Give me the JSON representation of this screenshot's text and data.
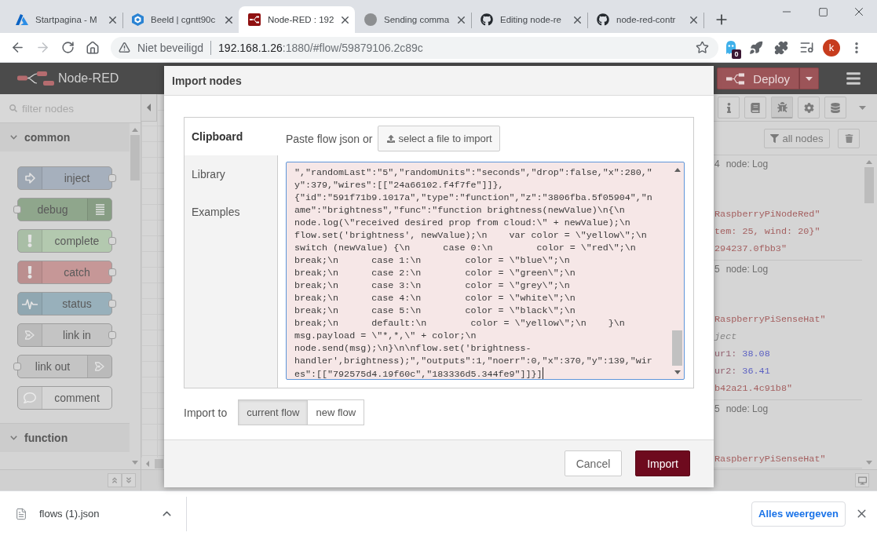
{
  "browser": {
    "tabs": [
      {
        "title": "Startpagina - M",
        "selected": false
      },
      {
        "title": "Beeld | cgntt90c",
        "selected": false
      },
      {
        "title": "Node-RED : 192",
        "selected": true
      },
      {
        "title": "Sending comma",
        "selected": false
      },
      {
        "title": "Editing node-re",
        "selected": false
      },
      {
        "title": "node-red-contr",
        "selected": false
      }
    ],
    "toolbar": {
      "forward_disabled": true,
      "security": "Niet beveiligd",
      "url_host": "192.168.1.26",
      "url_rest": ":1880/#flow/59879106.2c89c",
      "extension_badge": "0",
      "profile_initial": "k"
    }
  },
  "app": {
    "title": "Node-RED",
    "deploy": "Deploy",
    "palette": {
      "filter_placeholder": "filter nodes",
      "categories": [
        {
          "name": "common",
          "expanded": true,
          "nodes": [
            {
              "label": "inject",
              "kind": "input",
              "color": "#a6b0bd"
            },
            {
              "label": "debug",
              "kind": "output",
              "color": "#8fa68c"
            },
            {
              "label": "complete",
              "kind": "input",
              "color": "#b3c9af"
            },
            {
              "label": "catch",
              "kind": "input",
              "color": "#c69797"
            },
            {
              "label": "status",
              "kind": "input",
              "color": "#98b0bb"
            },
            {
              "label": "link in",
              "kind": "input",
              "color": "#c4c4c4"
            },
            {
              "label": "link out",
              "kind": "output",
              "color": "#c4c4c4"
            },
            {
              "label": "comment",
              "kind": "note",
              "color": "#d6d6d6"
            }
          ]
        },
        {
          "name": "function",
          "expanded": true
        }
      ]
    },
    "sidebar": {
      "tabs": [
        {
          "selected": false
        },
        {
          "selected": false
        },
        {
          "selected": true
        },
        {
          "selected": false
        },
        {
          "selected": false
        }
      ],
      "filter": "all nodes",
      "messages": [
        {
          "counter": "4",
          "node": "node: Log",
          "lines": [
            {
              "kind": "string",
              "text": "RaspberryPiNodeRed\""
            },
            {
              "kind": "string",
              "text": "tem: 25, wind: 20}\""
            },
            {
              "kind": "string",
              "text": "294237.0fbb3\""
            }
          ]
        },
        {
          "counter": "5",
          "node": "node: Log",
          "lines": [
            {
              "kind": "string",
              "text": "RaspberryPiSenseHat\""
            },
            {
              "kind": "type",
              "text": "ject"
            },
            {
              "kind": "number",
              "key": "ur1:",
              "value": "38.08"
            },
            {
              "kind": "number",
              "key": "ur2:",
              "value": "36.41"
            },
            {
              "kind": "string",
              "text": "b42a21.4c91b8\""
            }
          ]
        },
        {
          "counter": "5",
          "node": "node: Log",
          "lines": [
            {
              "kind": "string",
              "text": "RaspberryPiSenseHat\""
            }
          ]
        }
      ]
    }
  },
  "dialog": {
    "title": "Import nodes",
    "sources": [
      {
        "label": "Clipboard",
        "selected": true
      },
      {
        "label": "Library",
        "selected": false
      },
      {
        "label": "Examples",
        "selected": false
      }
    ],
    "paste_label": "Paste flow json or",
    "file_button": "select a file to import",
    "json_error": true,
    "json_lines": [
      "\",\"randomLast\":\"5\",\"randomUnits\":\"seconds\",\"drop\":false,\"x\":280,\"",
      "y\":379,\"wires\":[[\"24a66102.f4f7fe\"]]},",
      "{\"id\":\"591f71b9.1017a\",\"type\":\"function\",\"z\":\"3806fba.5f05904\",\"n",
      "ame\":\"brightness\",\"func\":\"function brightness(newValue)\\n{\\n",
      "node.log(\\\"received desired prop from cloud:\\\" + newValue);\\n",
      "flow.set('brightness', newValue);\\n    var color = \\\"yellow\\\";\\n",
      "switch (newValue) {\\n      case 0:\\n        color = \\\"red\\\";\\n",
      "break;\\n      case 1:\\n        color = \\\"blue\\\";\\n",
      "break;\\n      case 2:\\n        color = \\\"green\\\";\\n",
      "break;\\n      case 3:\\n        color = \\\"grey\\\";\\n",
      "break;\\n      case 4:\\n        color = \\\"white\\\";\\n",
      "break;\\n      case 5:\\n        color = \\\"black\\\";\\n",
      "break;\\n      default:\\n        color = \\\"yellow\\\";\\n    }\\n",
      "msg.payload = \\\"*,*,\\\" + color;\\n",
      "node.send(msg);\\n}\\n\\nflow.set('brightness-",
      "handler',brightness);\",\"outputs\":1,\"noerr\":0,\"x\":370,\"y\":139,\"wir",
      "es\":[[\"792575d4.19f60c\",\"183336d5.344fe9\"]]}]"
    ],
    "import_to_label": "Import to",
    "import_targets": [
      {
        "label": "current flow",
        "selected": true
      },
      {
        "label": "new flow",
        "selected": false
      }
    ],
    "buttons": [
      {
        "label": "Cancel",
        "kind": "cancel"
      },
      {
        "label": "Import",
        "kind": "submit"
      }
    ]
  },
  "download": {
    "file": "flows (1).json",
    "show_all": "Alles weergeven"
  }
}
